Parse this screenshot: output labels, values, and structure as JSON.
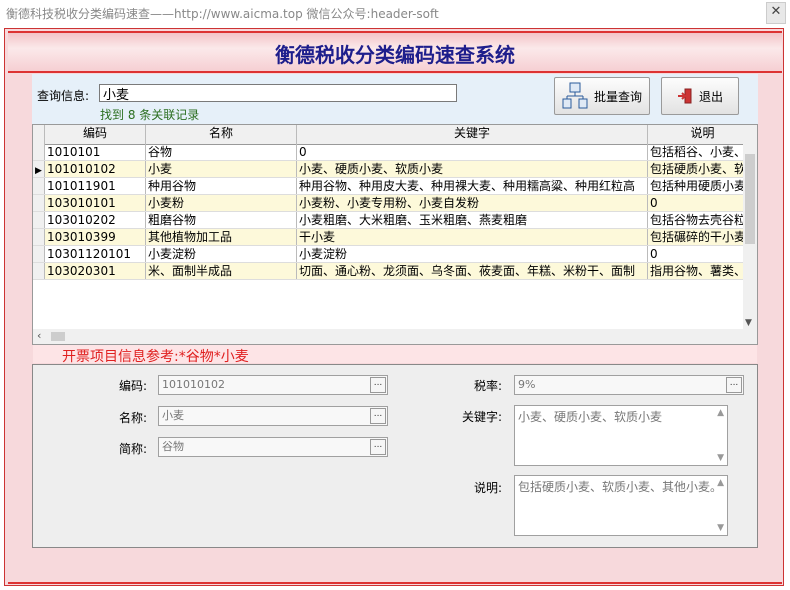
{
  "window": {
    "title": "衡德科技税收分类编码速查——http://www.aicma.top   微信公众号:header-soft",
    "close_glyph": "✕"
  },
  "app_title": "衡德税收分类编码速查系统",
  "query": {
    "label": "查询信息:",
    "value": "小麦",
    "result_text": "找到 8 条关联记录"
  },
  "buttons": {
    "batch_query": "批量查询",
    "exit": "退出"
  },
  "table": {
    "columns": [
      "编码",
      "名称",
      "关键字",
      "说明"
    ],
    "selected_row": 1,
    "rows": [
      [
        "1010101",
        "谷物",
        "0",
        "包括稻谷、小麦、玉"
      ],
      [
        "101010102",
        "小麦",
        "小麦、硬质小麦、软质小麦",
        "包括硬质小麦、软质"
      ],
      [
        "101011901",
        "种用谷物",
        "种用谷物、种用皮大麦、种用裸大麦、种用糯高粱、种用红粒高",
        "包括种用硬质小麦、"
      ],
      [
        "103010101",
        "小麦粉",
        "小麦粉、小麦专用粉、小麦自发粉",
        "0"
      ],
      [
        "103010202",
        "粗磨谷物",
        "小麦粗磨、大米粗磨、玉米粗磨、燕麦粗磨",
        "包括谷物去壳谷粒"
      ],
      [
        "103010399",
        "其他植物加工品",
        "干小麦",
        "包括碾碎的干小麦"
      ],
      [
        "10301120101",
        "小麦淀粉",
        "小麦淀粉",
        "0"
      ],
      [
        "103020301",
        "米、面制半成品",
        "切面、通心粉、龙须面、乌冬面、莜麦面、年糕、米粉干、面制",
        "指用谷物、薯类、"
      ]
    ]
  },
  "reference": {
    "text": "开票项目信息参考:*谷物*小麦"
  },
  "detail": {
    "code_label": "编码:",
    "code_value": "101010102",
    "name_label": "名称:",
    "name_value": "小麦",
    "short_label": "简称:",
    "short_value": "谷物",
    "tax_label": "税率:",
    "tax_value": "9%",
    "keyword_label": "关键字:",
    "keyword_value": "小麦、硬质小麦、软质小麦",
    "desc_label": "说明:",
    "desc_value": "包括硬质小麦、软质小麦、其他小麦。",
    "ellipsis": "..."
  },
  "colors": {
    "accent_red": "#dd3333",
    "title_blue": "#1e1e8c",
    "reference_red": "#e02020",
    "found_green": "#2b6e1f",
    "row_highlight": "#fdf9da"
  }
}
